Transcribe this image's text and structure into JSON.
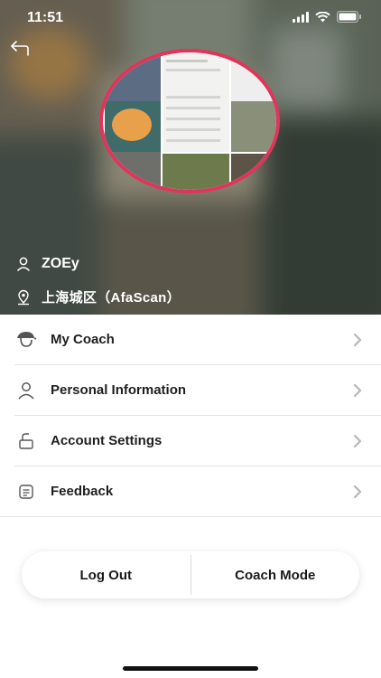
{
  "status_bar": {
    "time": "11:51"
  },
  "profile": {
    "name": "ZOEy",
    "location": "上海城区（AfaScan）"
  },
  "menu": {
    "items": [
      {
        "label": "My Coach",
        "icon": "coach-icon"
      },
      {
        "label": "Personal Information",
        "icon": "person-icon"
      },
      {
        "label": "Account Settings",
        "icon": "settings-icon"
      },
      {
        "label": "Feedback",
        "icon": "feedback-icon"
      }
    ]
  },
  "buttons": {
    "logout_label": "Log Out",
    "coach_mode_label": "Coach Mode"
  },
  "colors": {
    "avatar_border": "#e0355a",
    "text_primary": "#1f1f1f"
  }
}
